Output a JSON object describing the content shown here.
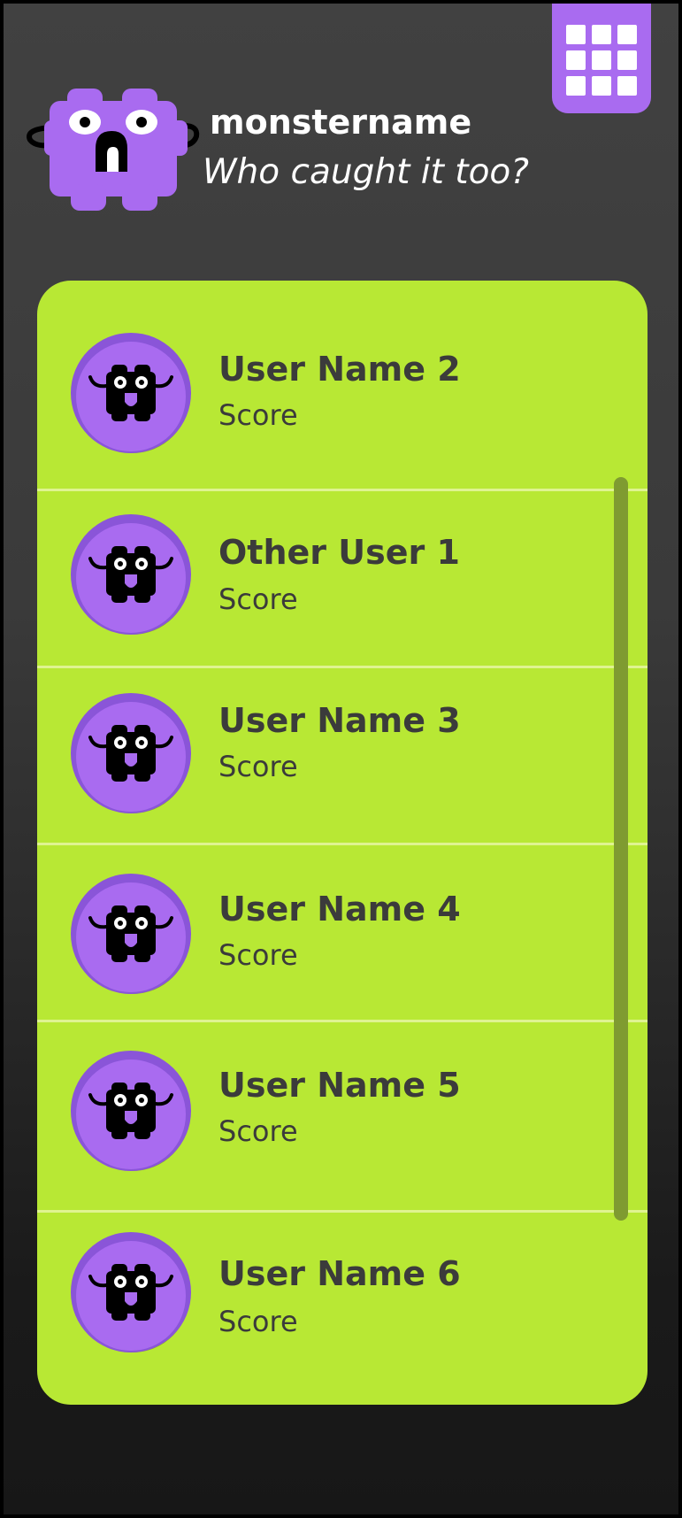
{
  "header": {
    "monster_name": "monstername",
    "subtitle": "Who caught it too?"
  },
  "icons": {
    "menu": "grid-menu-icon",
    "monster": "monster-mascot-icon",
    "avatar": "monster-avatar-icon"
  },
  "colors": {
    "background": "#3a3a3a",
    "panel": "#b8e834",
    "accent_purple": "#a96bf0",
    "text_dark": "#3b3b3b"
  },
  "users": [
    {
      "name": "User Name 2",
      "score_label": "Score"
    },
    {
      "name": "Other User 1",
      "score_label": "Score"
    },
    {
      "name": "User Name 3",
      "score_label": "Score"
    },
    {
      "name": "User Name 4",
      "score_label": "Score"
    },
    {
      "name": "User Name 5",
      "score_label": "Score"
    },
    {
      "name": "User Name 6",
      "score_label": "Score"
    }
  ]
}
